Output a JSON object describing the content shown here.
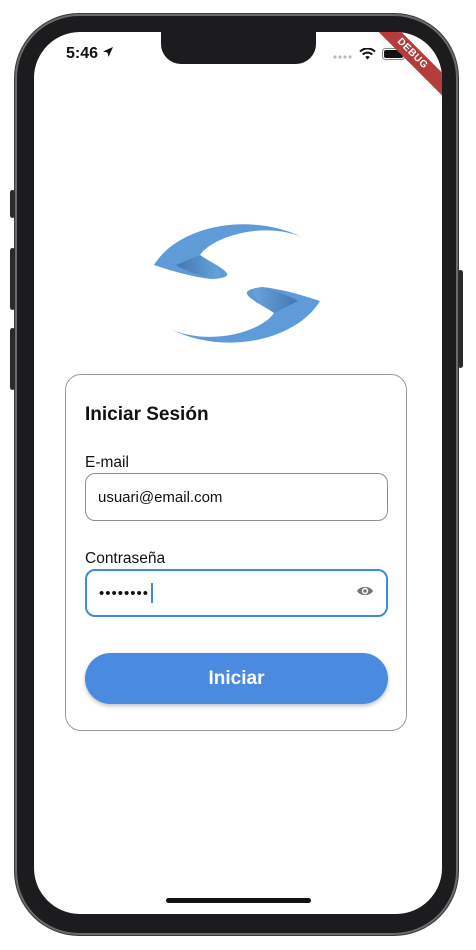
{
  "status_bar": {
    "time": "5:46",
    "debug_banner": "DEBUG"
  },
  "login": {
    "title": "Iniciar Sesión",
    "email_label": "E-mail",
    "email_value": "usuari@email.com",
    "password_label": "Contraseña",
    "password_value": "••••••••",
    "submit_label": "Iniciar"
  },
  "icons": {
    "location": "location-arrow-icon",
    "wifi": "wifi-icon",
    "battery": "battery-icon",
    "visibility": "eye-icon",
    "logo": "app-logo"
  },
  "colors": {
    "accent": "#4a8ae0",
    "focus_border": "#3f8ae0",
    "logo_blue": "#5a98d6",
    "debug_red": "#b63b3b"
  }
}
